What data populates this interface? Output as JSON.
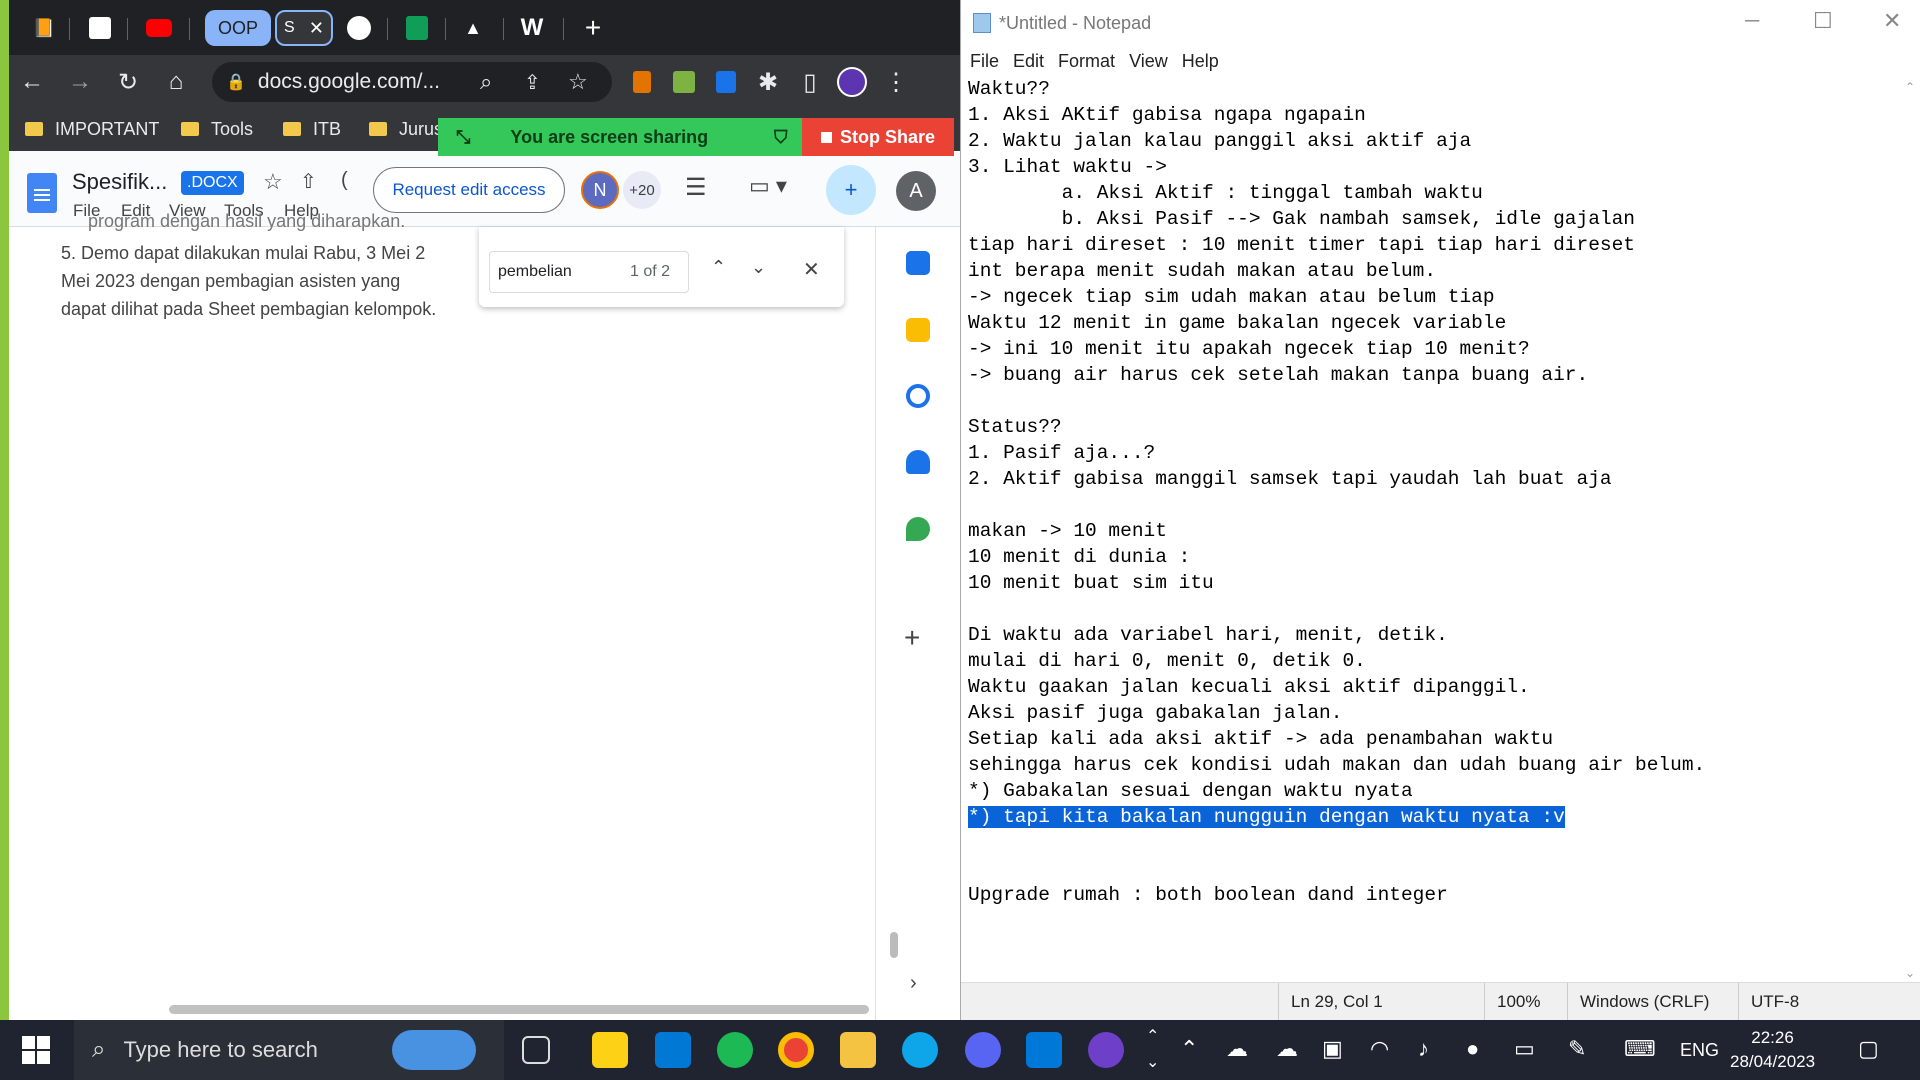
{
  "chrome": {
    "tabs": [
      "OOP",
      "S"
    ],
    "url": "docs.google.com/...",
    "bookmarks": [
      "IMPORTANT",
      "Tools",
      "ITB",
      "Jurusa"
    ],
    "share_text": "You are screen sharing",
    "stop_share": "Stop Share",
    "doc_title": "Spesifik...",
    "doc_badge": ".DOCX",
    "doc_menu": [
      "File",
      "Edit",
      "View",
      "Tools",
      "Help"
    ],
    "request_edit": "Request edit access",
    "avatar_n": "N",
    "plus_count": "+20",
    "avatar_a": "A",
    "doc_lines": [
      "program dengan hasil yang diharapkan.",
      "5.   Demo dapat dilakukan mulai Rabu, 3 Mei 2",
      "      Mei 2023 dengan pembagian asisten yang",
      "      dapat dilihat pada Sheet pembagian kelompok."
    ],
    "find_query": "pembelian",
    "find_count": "1 of 2"
  },
  "notepad": {
    "title": "*Untitled - Notepad",
    "menu": [
      "File",
      "Edit",
      "Format",
      "View",
      "Help"
    ],
    "lines": [
      "Waktu??",
      "1. Aksi AKtif gabisa ngapa ngapain",
      "2. Waktu jalan kalau panggil aksi aktif aja",
      "3. Lihat waktu ->",
      "        a. Aksi Aktif : tinggal tambah waktu",
      "        b. Aksi Pasif --> Gak nambah samsek, idle gajalan",
      "tiap hari direset : 10 menit timer tapi tiap hari direset",
      "int berapa menit sudah makan atau belum.",
      "-> ngecek tiap sim udah makan atau belum tiap",
      "Waktu 12 menit in game bakalan ngecek variable",
      "-> ini 10 menit itu apakah ngecek tiap 10 menit?",
      "-> buang air harus cek setelah makan tanpa buang air.",
      "",
      "Status??",
      "1. Pasif aja...?",
      "2. Aktif gabisa manggil samsek tapi yaudah lah buat aja",
      "",
      "makan -> 10 menit",
      "10 menit di dunia :",
      "10 menit buat sim itu",
      "",
      "Di waktu ada variabel hari, menit, detik.",
      "mulai di hari 0, menit 0, detik 0.",
      "Waktu gaakan jalan kecuali aksi aktif dipanggil.",
      "Aksi pasif juga gabakalan jalan.",
      "Setiap kali ada aksi aktif -> ada penambahan waktu",
      "sehingga harus cek kondisi udah makan dan udah buang air belum.",
      "*) Gabakalan sesuai dengan waktu nyata"
    ],
    "selected_line": "*) tapi kita bakalan nungguin dengan waktu nyata :v",
    "after_lines": [
      "",
      "",
      "Upgrade rumah : both boolean dand integer"
    ],
    "status": {
      "position": "Ln 29, Col 1",
      "zoom": "100%",
      "line_ending": "Windows (CRLF)",
      "encoding": "UTF-8"
    }
  },
  "taskbar": {
    "search_placeholder": "Type here to search",
    "language": "ENG",
    "time": "22:26",
    "date": "28/04/2023"
  }
}
